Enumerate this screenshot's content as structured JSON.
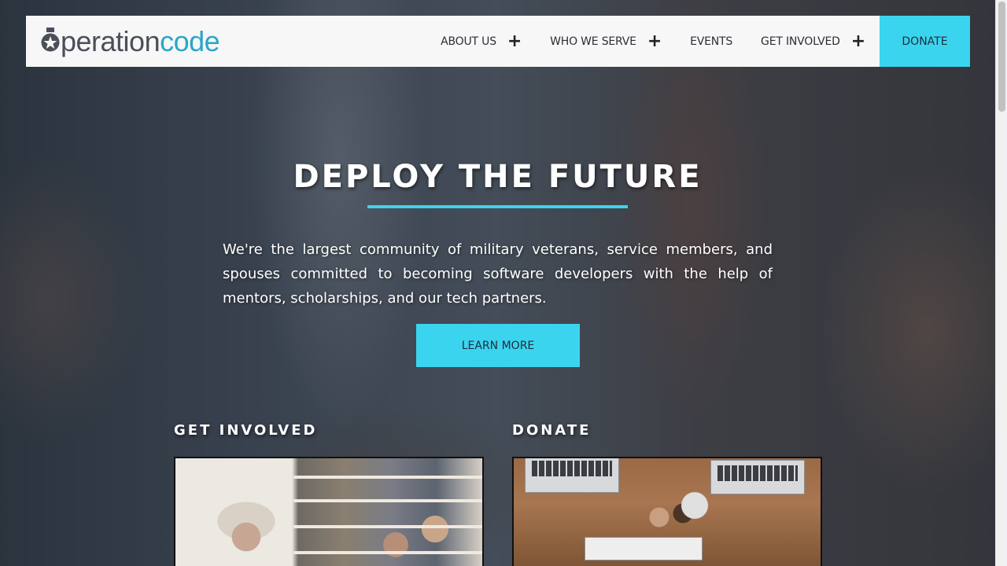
{
  "header": {
    "logo": {
      "text_part1": "peration",
      "text_part2": "code"
    },
    "nav": [
      {
        "label": "ABOUT US",
        "has_submenu": true
      },
      {
        "label": "WHO WE SERVE",
        "has_submenu": true
      },
      {
        "label": "EVENTS",
        "has_submenu": false
      },
      {
        "label": "GET INVOLVED",
        "has_submenu": true
      }
    ],
    "expand_icon": "+",
    "donate_label": "DONATE"
  },
  "hero": {
    "title": "DEPLOY THE FUTURE",
    "description": "We're the largest community of military veterans, service members, and spouses committed to becoming software developers with the help of mentors, scholarships, and our tech partners.",
    "cta_label": "LEARN MORE"
  },
  "sections": [
    {
      "heading": "GET INVOLVED"
    },
    {
      "heading": "DONATE"
    }
  ],
  "colors": {
    "accent": "#3bd4ef",
    "logo_gray": "#4a4f5a",
    "logo_blue": "#2aa7c7",
    "navbar_bg": "#f7f7f7"
  }
}
